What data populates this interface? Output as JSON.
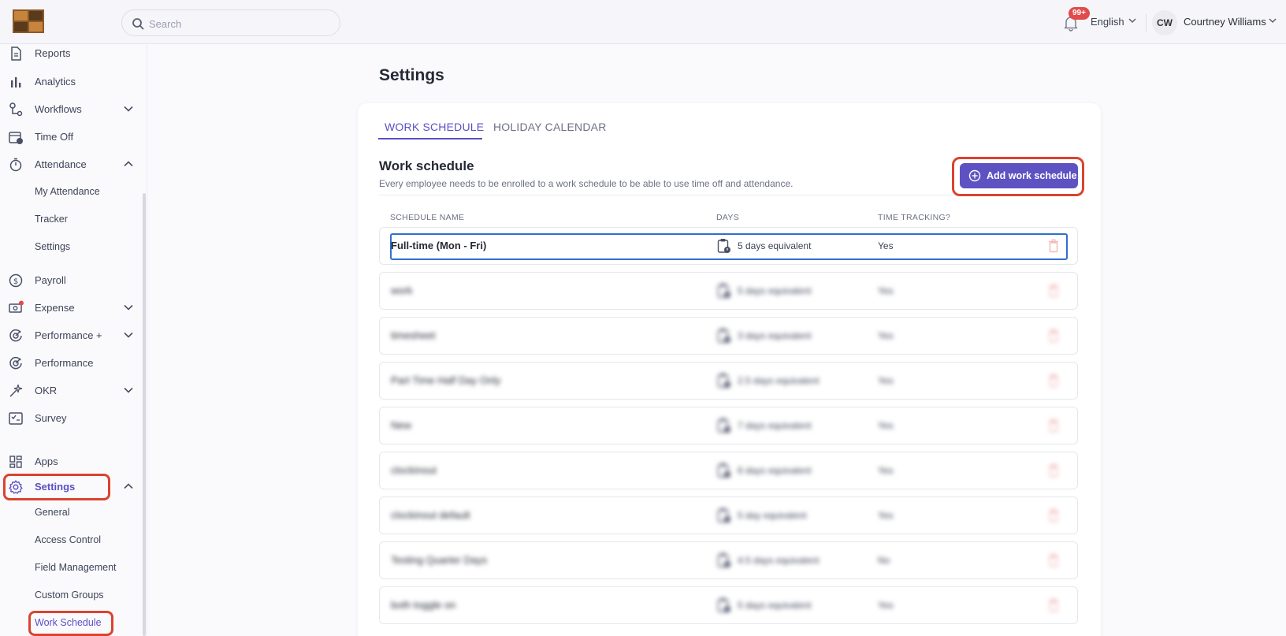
{
  "header": {
    "search_placeholder": "Search",
    "notification_badge": "99+",
    "language": "English",
    "user_initials": "CW",
    "user_name": "Courtney Williams"
  },
  "sidebar": {
    "items": [
      {
        "label": "Reports",
        "icon": "document-icon"
      },
      {
        "label": "Analytics",
        "icon": "bar-chart-icon"
      },
      {
        "label": "Workflows",
        "icon": "workflow-icon",
        "chevron": "down"
      },
      {
        "label": "Time Off",
        "icon": "calendar-clock-icon"
      },
      {
        "label": "Attendance",
        "icon": "stopwatch-icon",
        "chevron": "up"
      },
      {
        "label": "Payroll",
        "icon": "dollar-circle-icon"
      },
      {
        "label": "Expense",
        "icon": "receipt-icon",
        "chevron": "down"
      },
      {
        "label": "Performance +",
        "icon": "target-icon",
        "chevron": "down"
      },
      {
        "label": "Performance",
        "icon": "target-icon"
      },
      {
        "label": "OKR",
        "icon": "sparkle-icon",
        "chevron": "down"
      },
      {
        "label": "Survey",
        "icon": "survey-icon"
      },
      {
        "label": "Apps",
        "icon": "apps-grid-icon"
      },
      {
        "label": "Settings",
        "icon": "gear-icon",
        "chevron": "up"
      }
    ],
    "attendance_sub": [
      "My Attendance",
      "Tracker",
      "Settings"
    ],
    "settings_sub": [
      "General",
      "Access Control",
      "Field Management",
      "Custom Groups",
      "Work Schedule"
    ]
  },
  "main": {
    "page_title": "Settings",
    "tabs": [
      "WORK SCHEDULE",
      "HOLIDAY CALENDAR"
    ],
    "section_title": "Work schedule",
    "section_desc": "Every employee needs to be enrolled to a work schedule to be able to use time off and attendance.",
    "add_button": "Add work schedule",
    "columns": [
      "SCHEDULE NAME",
      "DAYS",
      "TIME TRACKING?"
    ],
    "rows": [
      {
        "name": "Full-time (Mon - Fri)",
        "days": "5 days equivalent",
        "tracking": "Yes"
      },
      {
        "name": "work",
        "days": "5 days equivalent",
        "tracking": "Yes"
      },
      {
        "name": "timesheet",
        "days": "3 days equivalent",
        "tracking": "Yes"
      },
      {
        "name": "Part Time Half Day Only",
        "days": "2.5 days equivalent",
        "tracking": "Yes"
      },
      {
        "name": "New",
        "days": "7 days equivalent",
        "tracking": "Yes"
      },
      {
        "name": "clockinout",
        "days": "6 days equivalent",
        "tracking": "Yes"
      },
      {
        "name": "clockinout default",
        "days": "5 day equivalent",
        "tracking": "Yes"
      },
      {
        "name": "Testing Quarter Days",
        "days": "4.5 days equivalent",
        "tracking": "No"
      },
      {
        "name": "both toggle on",
        "days": "5 days equivalent",
        "tracking": "Yes"
      }
    ]
  },
  "colors": {
    "accent": "#5e52c2",
    "highlight": "#d9442f",
    "focus": "#2f6fd0",
    "danger": "#f2b8b8"
  }
}
